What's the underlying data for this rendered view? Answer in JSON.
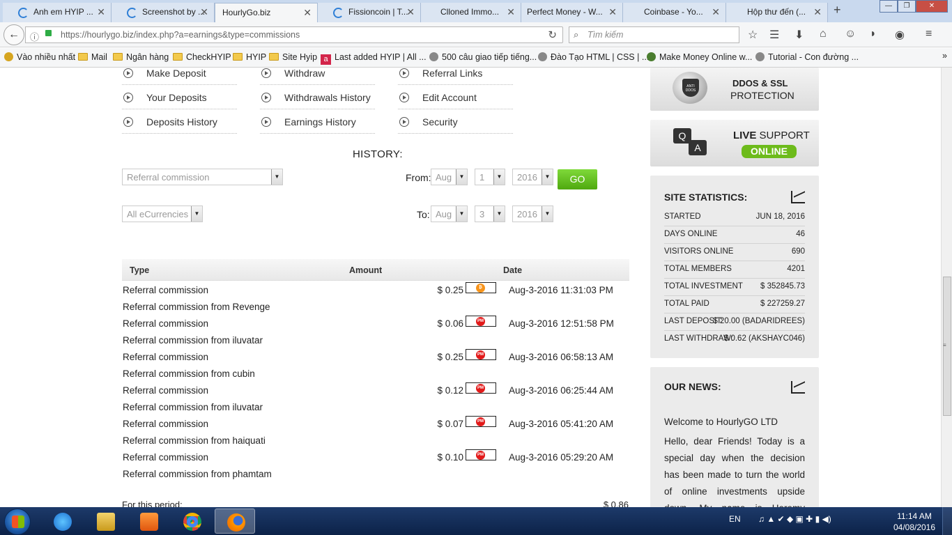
{
  "browser": {
    "tabs": [
      {
        "label": "Anh em HYIP ...",
        "active": false
      },
      {
        "label": "Screenshot by ...",
        "active": false
      },
      {
        "label": "HourlyGo.biz",
        "active": true
      },
      {
        "label": "Fissioncoin | T...",
        "active": false
      },
      {
        "label": "Clloned Immo...",
        "active": false
      },
      {
        "label": "Perfect Money - W...",
        "active": false
      },
      {
        "label": "Coinbase - Yo...",
        "active": false
      },
      {
        "label": "Hộp thư đến (...",
        "active": false
      }
    ],
    "url": "https://hourlygo.biz/index.php?a=earnings&type=commissions",
    "search_placeholder": "Tìm kiếm",
    "bookmarks": [
      "Vào nhiều nhất",
      "Mail",
      "Ngân hàng",
      "CheckHYIP",
      "HYIP",
      "Site Hyip",
      "Last added HYIP | All ...",
      "500 câu giao tiếp tiếng...",
      "Đào Tạo HTML | CSS | ...",
      "Make Money Online w...",
      "Tutorial - Con đường ..."
    ]
  },
  "account_menu": [
    [
      "Make Deposit",
      "Withdraw",
      "Referral Links"
    ],
    [
      "Your Deposits",
      "Withdrawals History",
      "Edit Account"
    ],
    [
      "Deposits History",
      "Earnings History",
      "Security"
    ]
  ],
  "history": {
    "title": "HISTORY:",
    "type_select": "Referral commission",
    "currency_select": "All eCurrencies",
    "from_label": "From:",
    "to_label": "To:",
    "from": {
      "month": "Aug",
      "day": "1",
      "year": "2016"
    },
    "to": {
      "month": "Aug",
      "day": "3",
      "year": "2016"
    },
    "go_label": "GO",
    "columns": [
      "Type",
      "Amount",
      "Date"
    ],
    "rows": [
      {
        "type": "Referral commission",
        "detail": "Referral commission from Revenge",
        "amount": "$ 0.25",
        "currency_icon": "bitcoin-icon",
        "date": "Aug-3-2016 11:31:03 PM"
      },
      {
        "type": "Referral commission",
        "detail": "Referral commission from iluvatar",
        "amount": "$ 0.06",
        "currency_icon": "perfect-money-icon",
        "date": "Aug-3-2016 12:51:58 PM"
      },
      {
        "type": "Referral commission",
        "detail": "Referral commission from cubin",
        "amount": "$ 0.25",
        "currency_icon": "perfect-money-icon",
        "date": "Aug-3-2016 06:58:13 AM"
      },
      {
        "type": "Referral commission",
        "detail": "Referral commission from iluvatar",
        "amount": "$ 0.12",
        "currency_icon": "perfect-money-icon",
        "date": "Aug-3-2016 06:25:44 AM"
      },
      {
        "type": "Referral commission",
        "detail": "Referral commission from haiquati",
        "amount": "$ 0.07",
        "currency_icon": "perfect-money-icon",
        "date": "Aug-3-2016 05:41:20 AM"
      },
      {
        "type": "Referral commission",
        "detail": "Referral commission from phamtam",
        "amount": "$ 0.10",
        "currency_icon": "perfect-money-icon",
        "date": "Aug-3-2016 05:29:20 AM"
      }
    ],
    "period_label": "For this period:",
    "period_total": "$ 0.86",
    "pm_badge": "PM"
  },
  "sidebar": {
    "ddos_line1": "DDOS & SSL",
    "ddos_line2": "PROTECTION",
    "ddos_badge": "ANTI DDOS",
    "live_bold": "LIVE",
    "live_rest": " SUPPORT",
    "online": "ONLINE",
    "qa_q": "Q",
    "qa_a": "A",
    "stats_title": "SITE STATISTICS:",
    "stats": [
      {
        "k": "STARTED",
        "v": "JUN 18, 2016"
      },
      {
        "k": "DAYS ONLINE",
        "v": "46"
      },
      {
        "k": "VISITORS ONLINE",
        "v": "690"
      },
      {
        "k": "TOTAL MEMBERS",
        "v": "4201"
      },
      {
        "k": "TOTAL INVESTMENT",
        "v": "$ 352845.73"
      },
      {
        "k": "TOTAL PAID",
        "v": "$ 227259.27"
      },
      {
        "k": "LAST DEPOSIT:",
        "v": "$ 20.00 (BADARIDREES)"
      },
      {
        "k": "LAST WITHDRAW:",
        "v": "$ 0.62 (AKSHAYC046)"
      }
    ],
    "news_title": "OUR NEWS:",
    "news_welcome": "Welcome to HourlyGO LTD",
    "news_body": "Hello, dear Friends! Today is a special day when the decision has been made to turn the world of online investments upside down. My name is Heremy Papman and I"
  },
  "taskbar": {
    "lang": "EN",
    "time": "11:14 AM",
    "date": "04/08/2016"
  },
  "colors": {
    "accent_green": "#6dbb1b",
    "pm_red": "#e21a1a",
    "bitcoin_orange": "#f7931a"
  }
}
